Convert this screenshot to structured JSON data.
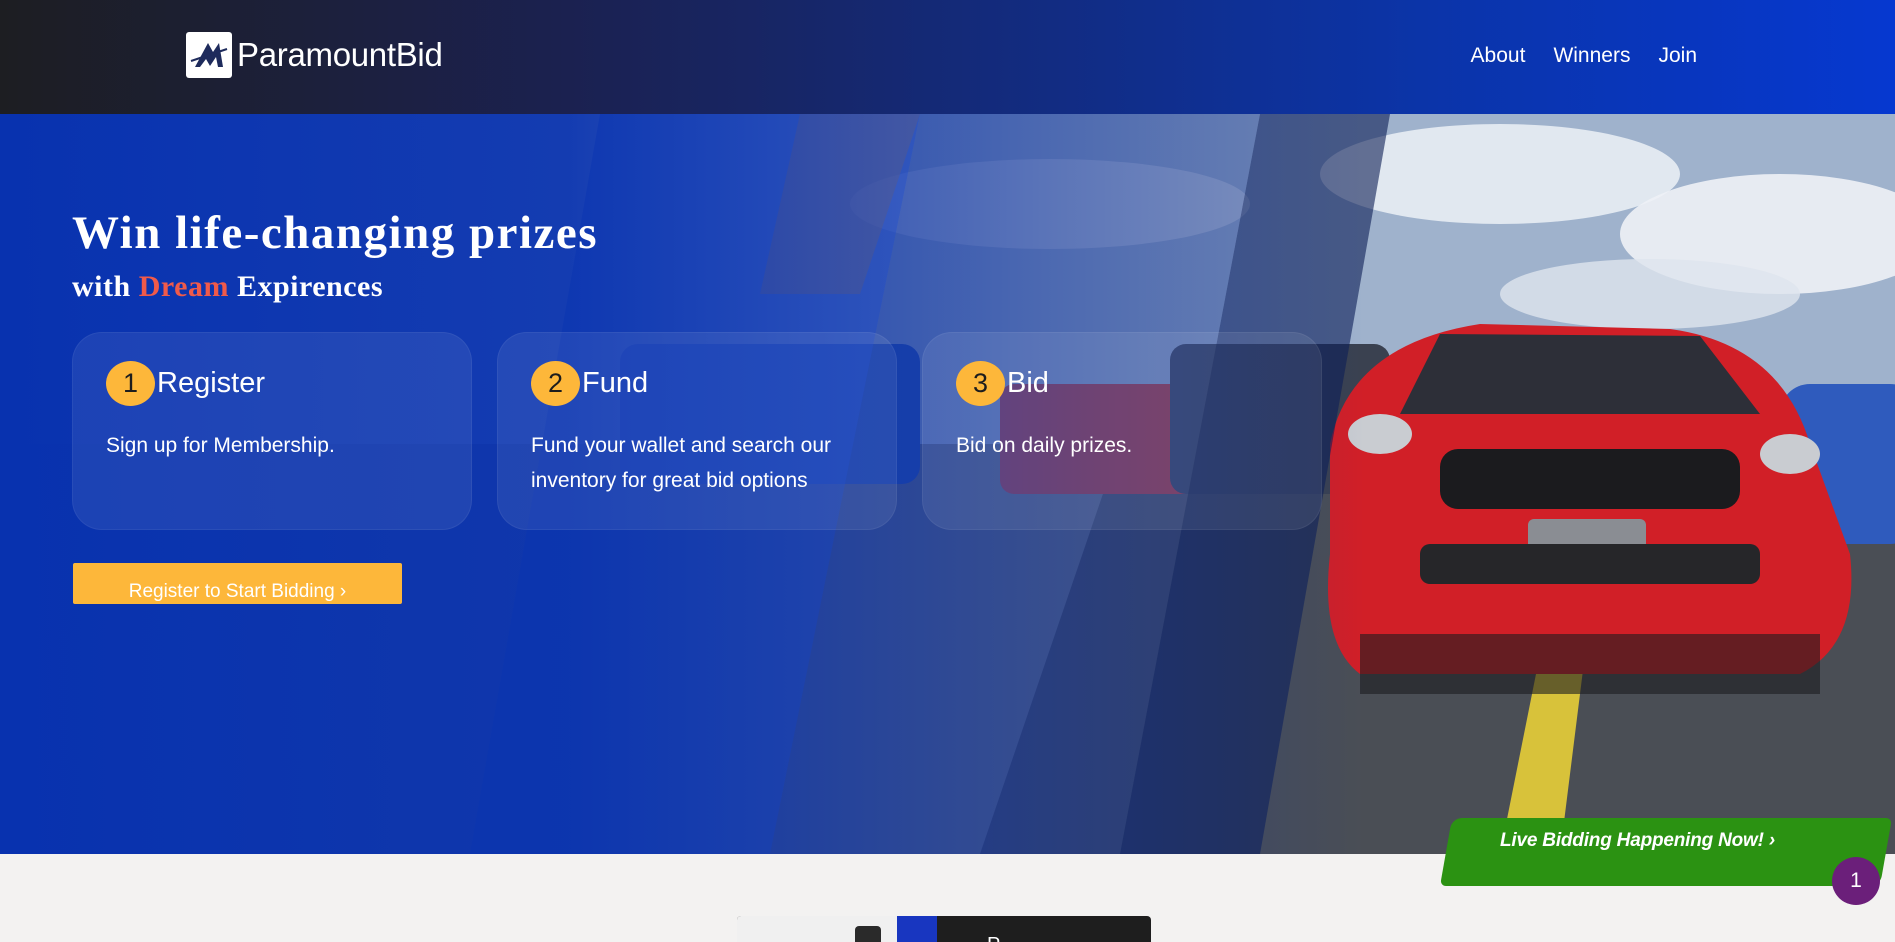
{
  "header": {
    "brand": "ParamountBid",
    "nav": [
      {
        "label": "About"
      },
      {
        "label": "Winners"
      },
      {
        "label": "Join"
      }
    ]
  },
  "hero": {
    "title": "Win life-changing prizes",
    "subtitle_prefix": "with",
    "subtitle_accent": "Dream",
    "subtitle_suffix": "Expirences",
    "steps": [
      {
        "number": "1",
        "title": "Register",
        "description": "Sign up for Membership."
      },
      {
        "number": "2",
        "title": "Fund",
        "description": "Fund your wallet and search our inventory for great bid options"
      },
      {
        "number": "3",
        "title": "Bid",
        "description": "Bid on daily prizes."
      }
    ],
    "cta_label": "Register to Start Bidding ›"
  },
  "live": {
    "label": "Live Bidding Happening Now!  ›",
    "badge_count": "1"
  },
  "below": {
    "card_text": "P"
  },
  "colors": {
    "accent": "#fdb73a",
    "brand_blue": "#0836b4",
    "live_green": "#2b9212",
    "dream_red": "#f05a4a",
    "badge_purple": "#6b1f7a"
  }
}
